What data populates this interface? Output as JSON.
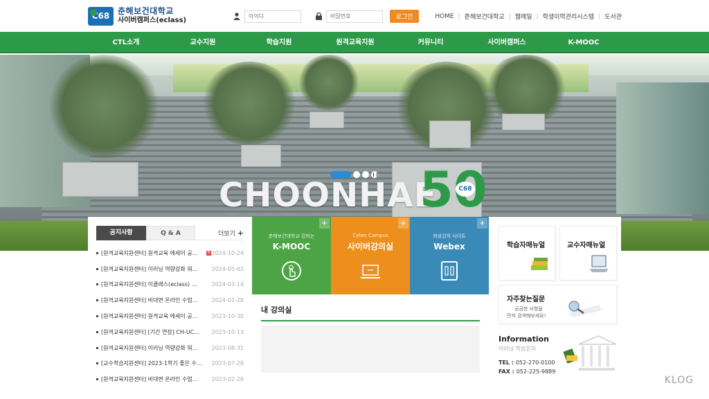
{
  "header": {
    "logo_mark": "C68",
    "logo_name": "춘해보건대학교",
    "logo_sub": "사이버캠퍼스(eclass)",
    "login": {
      "id_placeholder": "아이디",
      "pw_placeholder": "비밀번호",
      "button": "로그인"
    },
    "toplinks": [
      "HOME",
      "춘해보건대학교",
      "웹메일",
      "학생이력관리시스템",
      "도서관"
    ]
  },
  "nav": [
    "CTL소개",
    "교수지원",
    "학습지원",
    "원격교육지원",
    "커뮤니티",
    "사이버캠퍼스",
    "K-MOOC"
  ],
  "hero": {
    "brand": "CHOONHAE",
    "anniversary": "50",
    "badge": "C68"
  },
  "notice": {
    "tabs": [
      "공지사항",
      "Q & A"
    ],
    "more": "더보기",
    "items": [
      {
        "title": "[원격교육지원센터] 원격교육 에세이 공…",
        "date": "2024-10-24",
        "new": true
      },
      {
        "title": "[원격교육지원센터] 이러닝 역량강화 워…",
        "date": "2024-05-02",
        "new": false
      },
      {
        "title": "[원격교육지원센터] 이클래스(eclass) …",
        "date": "2024-03-14",
        "new": false
      },
      {
        "title": "[원격교육지원센터] 비대면 온라인 수업…",
        "date": "2024-02-28",
        "new": false
      },
      {
        "title": "[원격교육지원센터] 원격교육 에세이 공…",
        "date": "2023-10-30",
        "new": false
      },
      {
        "title": "[원격교육지원센터] [기간 연장] CH-UC…",
        "date": "2023-10-13",
        "new": false
      },
      {
        "title": "[원격교육지원센터] 이러닝 역량강화 워…",
        "date": "2023-08-31",
        "new": false
      },
      {
        "title": "[교수학습지원센터] 2023-1학기 좋은 수…",
        "date": "2023-07-28",
        "new": false
      },
      {
        "title": "[원격교육지원센터] 비대면 온라인 수업…",
        "date": "2023-02-28",
        "new": false
      }
    ]
  },
  "tiles": [
    {
      "sub": "춘해보건대학교 강좌는",
      "title": "K-MOOC",
      "icon": "touch-icon",
      "color": "#4ca445"
    },
    {
      "sub": "Cyber Campus",
      "title": "사이버강의실",
      "icon": "laptop-icon",
      "color": "#ec8f1c"
    },
    {
      "sub": "화상강의 사이트",
      "title": "Webex",
      "icon": "phone-icon",
      "color": "#3a8ab7"
    }
  ],
  "myclass": {
    "title": "내 강의실"
  },
  "right": {
    "student_manual": "학습자매뉴얼",
    "professor_manual": "교수자매뉴얼",
    "faq_title": "자주찾는질문",
    "faq_sub_1": "궁금한 사항을",
    "faq_sub_2": "먼저 검색해보세요!",
    "info_title": "Information",
    "info_sub": "이러닝 학습문의",
    "tel_label": "TEL :",
    "tel": "052-270-0100",
    "fax_label": "FAX :",
    "fax": "052-225-9889"
  },
  "watermark": "KLOG"
}
